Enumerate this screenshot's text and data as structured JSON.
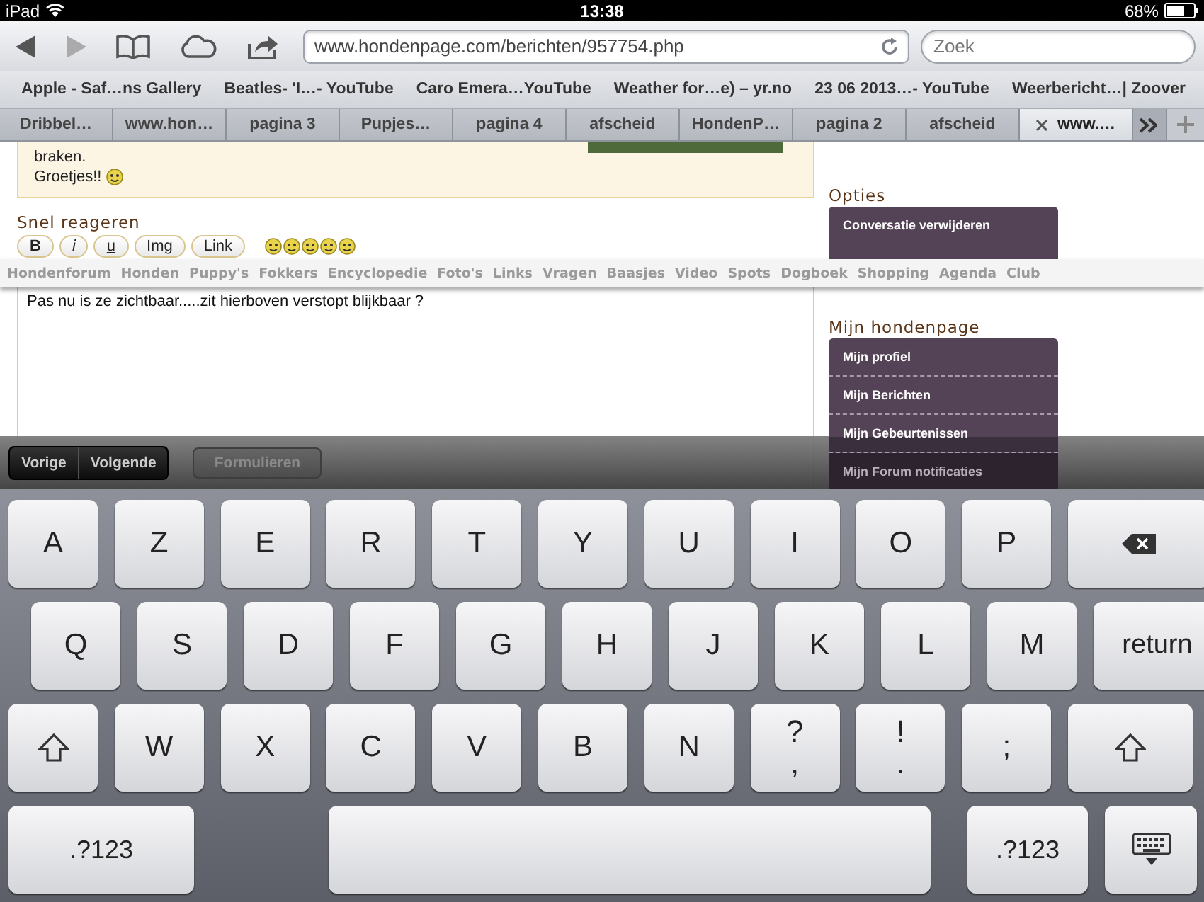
{
  "status_bar": {
    "device": "iPad",
    "time": "13:38",
    "battery": "68%"
  },
  "toolbar": {
    "url": "www.hondenpage.com/berichten/957754.php",
    "search_placeholder": "Zoek"
  },
  "bookmarks": [
    "Apple - Saf…ns Gallery",
    "Beatles- 'I…- YouTube",
    "Caro Emera…YouTube",
    "Weather for…e) – yr.no",
    "23 06 2013…- YouTube",
    "Weerbericht…| Zoover"
  ],
  "tabs": [
    {
      "label": "Dribbel…",
      "selected": false
    },
    {
      "label": "www.hon…",
      "selected": false
    },
    {
      "label": "pagina 3",
      "selected": false
    },
    {
      "label": "Pupjes…",
      "selected": false
    },
    {
      "label": "pagina 4",
      "selected": false
    },
    {
      "label": "afscheid",
      "selected": false
    },
    {
      "label": "HondenP…",
      "selected": false
    },
    {
      "label": "pagina 2",
      "selected": false
    },
    {
      "label": "afscheid",
      "selected": false
    },
    {
      "label": "www.…",
      "selected": true
    }
  ],
  "message": {
    "lines": [
      "braken.",
      "Groetjes!!"
    ]
  },
  "quick_reply": {
    "title": "Snel reageren",
    "buttons": [
      {
        "label": "B",
        "kind": "bold"
      },
      {
        "label": "i",
        "kind": "italic"
      },
      {
        "label": "u",
        "kind": "underline"
      },
      {
        "label": "Img",
        "kind": "plain"
      },
      {
        "label": "Link",
        "kind": "plain"
      }
    ]
  },
  "options": {
    "title": "Opties",
    "items": [
      "Conversatie verwijderen"
    ]
  },
  "nav": [
    "Hondenforum",
    "Honden",
    "Puppy's",
    "Fokkers",
    "Encyclopedie",
    "Foto's",
    "Links",
    "Vragen",
    "Baasjes",
    "Video",
    "Spots",
    "Dogboek",
    "Shopping",
    "Agenda",
    "Club"
  ],
  "reply_text": "Pas nu is ze zichtbaar.....zit hierboven verstopt blijkbaar ?",
  "my_page": {
    "title": "Mijn hondenpage",
    "items": [
      "Mijn profiel",
      "Mijn Berichten",
      "Mijn Gebeurtenissen",
      "Mijn Forum notificaties"
    ]
  },
  "form_bar": {
    "buttons": [
      {
        "label": "Vorige",
        "disabled": false
      },
      {
        "label": "Volgende",
        "disabled": false
      },
      {
        "label": "Formulieren",
        "disabled": true
      }
    ]
  },
  "keyboard": [
    [
      {
        "kind": "char",
        "label": "A"
      },
      {
        "kind": "char",
        "label": "Z"
      },
      {
        "kind": "char",
        "label": "E"
      },
      {
        "kind": "char",
        "label": "R"
      },
      {
        "kind": "char",
        "label": "T"
      },
      {
        "kind": "char",
        "label": "Y"
      },
      {
        "kind": "char",
        "label": "U"
      },
      {
        "kind": "char",
        "label": "I"
      },
      {
        "kind": "char",
        "label": "O"
      },
      {
        "kind": "char",
        "label": "P"
      },
      {
        "kind": "backspace"
      }
    ],
    [
      {
        "kind": "char",
        "label": "Q"
      },
      {
        "kind": "char",
        "label": "S"
      },
      {
        "kind": "char",
        "label": "D"
      },
      {
        "kind": "char",
        "label": "F"
      },
      {
        "kind": "char",
        "label": "G"
      },
      {
        "kind": "char",
        "label": "H"
      },
      {
        "kind": "char",
        "label": "J"
      },
      {
        "kind": "char",
        "label": "K"
      },
      {
        "kind": "char",
        "label": "L"
      },
      {
        "kind": "char",
        "label": "M"
      },
      {
        "kind": "return",
        "label": "return"
      }
    ],
    [
      {
        "kind": "shift"
      },
      {
        "kind": "char",
        "label": "W"
      },
      {
        "kind": "char",
        "label": "X"
      },
      {
        "kind": "char",
        "label": "C"
      },
      {
        "kind": "char",
        "label": "V"
      },
      {
        "kind": "char",
        "label": "B"
      },
      {
        "kind": "char",
        "label": "N"
      },
      {
        "kind": "double",
        "label": "?",
        "sub": ","
      },
      {
        "kind": "double",
        "label": "!",
        "sub": "."
      },
      {
        "kind": "char",
        "label": ";"
      },
      {
        "kind": "shift"
      }
    ],
    [
      {
        "kind": "mode",
        "label": ".?123"
      },
      {
        "kind": "space"
      },
      {
        "kind": "mode",
        "label": ".?123"
      },
      {
        "kind": "dismiss"
      }
    ]
  ]
}
